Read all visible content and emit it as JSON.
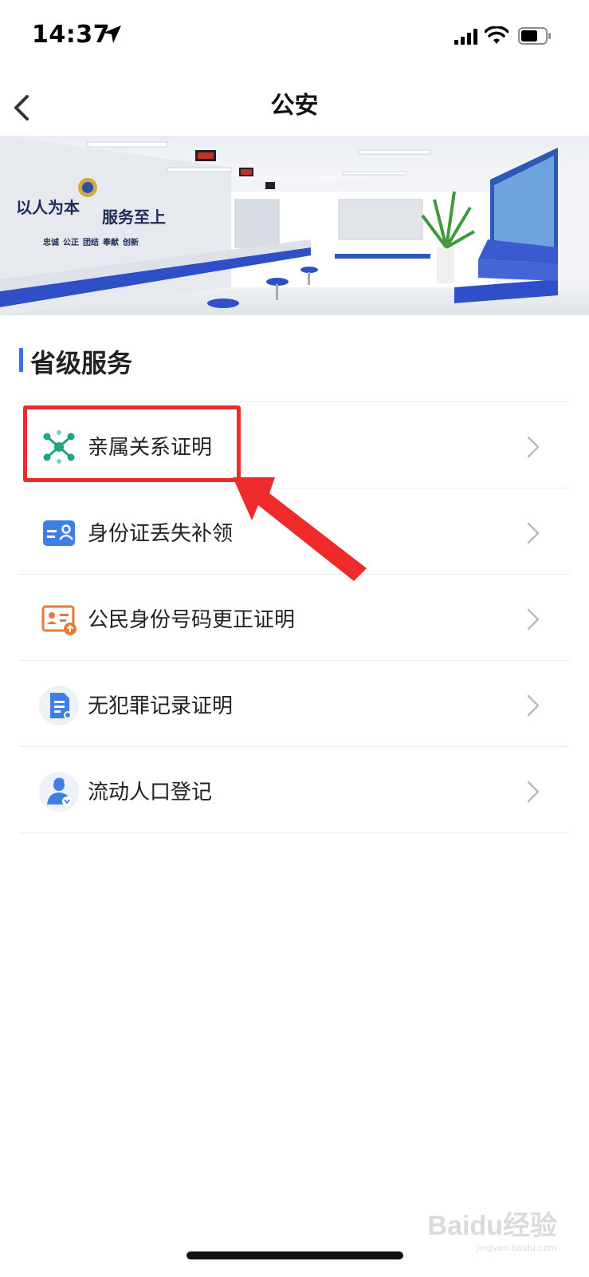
{
  "status_bar": {
    "time": "14:37"
  },
  "nav": {
    "title": "公安"
  },
  "banner": {
    "slogan_left": "以人为本",
    "slogan_right": "服务至上",
    "values_line": "忠诚  公正  团结  奉献  创新"
  },
  "section": {
    "title": "省级服务"
  },
  "services": [
    {
      "label": "亲属关系证明",
      "icon": "network-nodes-icon",
      "color": "#1fa77a"
    },
    {
      "label": "身份证丢失补领",
      "icon": "id-card-icon",
      "color": "#3d7ee8"
    },
    {
      "label": "公民身份号码更正证明",
      "icon": "id-card-upload-icon",
      "color": "#e8793d"
    },
    {
      "label": "无犯罪记录证明",
      "icon": "document-icon",
      "color": "#3d7ee8"
    },
    {
      "label": "流动人口登记",
      "icon": "person-badge-icon",
      "color": "#3d7ee8"
    }
  ],
  "annotation": {
    "highlight_color": "#ee2a2a"
  },
  "watermark": {
    "main": "Baidu经验",
    "sub": "jingyan.baidu.com"
  }
}
